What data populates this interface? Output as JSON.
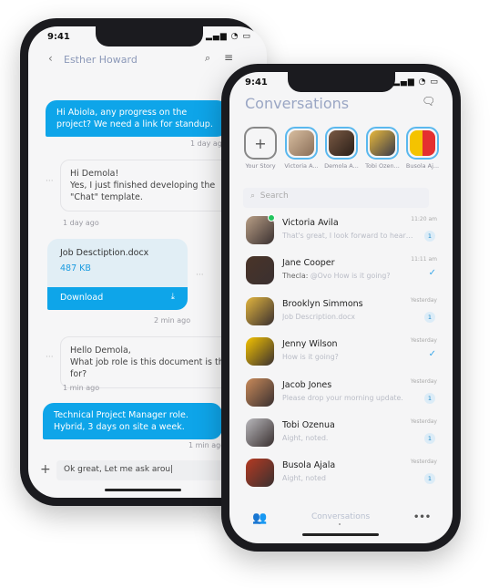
{
  "chat_screen": {
    "status_time": "9:41",
    "header": {
      "back_icon": "chevron-left-icon",
      "title": "Esther Howard",
      "search_icon": "search-icon",
      "menu_icon": "hamburger-icon"
    },
    "messages": [
      {
        "direction": "out",
        "lines": [
          "Hi Abiola, any progress on the",
          "project? We need a link for standup."
        ],
        "time": "1 day ago"
      },
      {
        "direction": "in",
        "lines": [
          "Hi Demola!",
          "Yes, I just finished developing the",
          "\"Chat\" template."
        ],
        "time": "1 day ago"
      },
      {
        "direction": "in",
        "type": "file",
        "file_name": "Job Desctiption.docx",
        "file_size": "487 KB",
        "action": "Download",
        "time": "2 min ago"
      },
      {
        "direction": "in",
        "lines": [
          "Hello Demola,",
          "What job role is this document is this",
          "for?"
        ],
        "time": "1 min ago"
      },
      {
        "direction": "out",
        "lines": [
          "Technical Project Manager role.",
          "Hybrid, 3 days on site a week."
        ],
        "time": "1 min ago"
      }
    ],
    "composer": {
      "value": "Ok great, Let me ask arou|",
      "add_icon": "plus-icon"
    }
  },
  "conversations_screen": {
    "status_time": "9:41",
    "title": "Conversations",
    "new_chat_icon": "new-message-icon",
    "stories": [
      {
        "label": "Your Story",
        "icon": "plus-icon"
      },
      {
        "label": "Victoria A...",
        "color": "#c9a98a"
      },
      {
        "label": "Demola A...",
        "color": "#5a4030"
      },
      {
        "label": "Tobi Ozen...",
        "color": "#e8b93c"
      },
      {
        "label": "Busola Aj...",
        "color": "#f2c200"
      }
    ],
    "search_placeholder": "Search",
    "conversations": [
      {
        "name": "Victoria Avila",
        "message": "That's great, I look forward to hearing ba...",
        "time": "11:20 am",
        "unread": "1",
        "online": true,
        "color": "#b99f86"
      },
      {
        "name": "Jane Cooper",
        "sender": "Thecla:",
        "message": "@Ovo How is it going?",
        "time": "11:11 am",
        "read": true,
        "color": "#4a3428"
      },
      {
        "name": "Brooklyn Simmons",
        "message": "Job Description.docx",
        "time": "Yesterday",
        "unread": "1",
        "color": "#e2b53e"
      },
      {
        "name": "Jenny Wilson",
        "message": "How is it going?",
        "time": "Yesterday",
        "read": true,
        "color": "#f4c300"
      },
      {
        "name": "Jacob Jones",
        "message": "Please drop your morning update.",
        "time": "Yesterday",
        "unread": "1",
        "color": "#c98a5a"
      },
      {
        "name": "Tobi Ozenua",
        "message": "Aight, noted.",
        "time": "Yesterday",
        "unread": "1",
        "color": "#b8b8bc"
      },
      {
        "name": "Busola Ajala",
        "message": "Aight, noted",
        "time": "Yesterday",
        "unread": "1",
        "color": "#b53a22"
      }
    ],
    "bottom_nav": {
      "contacts_icon": "users-icon",
      "active_label": "Conversations",
      "more_icon": "more-icon"
    }
  }
}
